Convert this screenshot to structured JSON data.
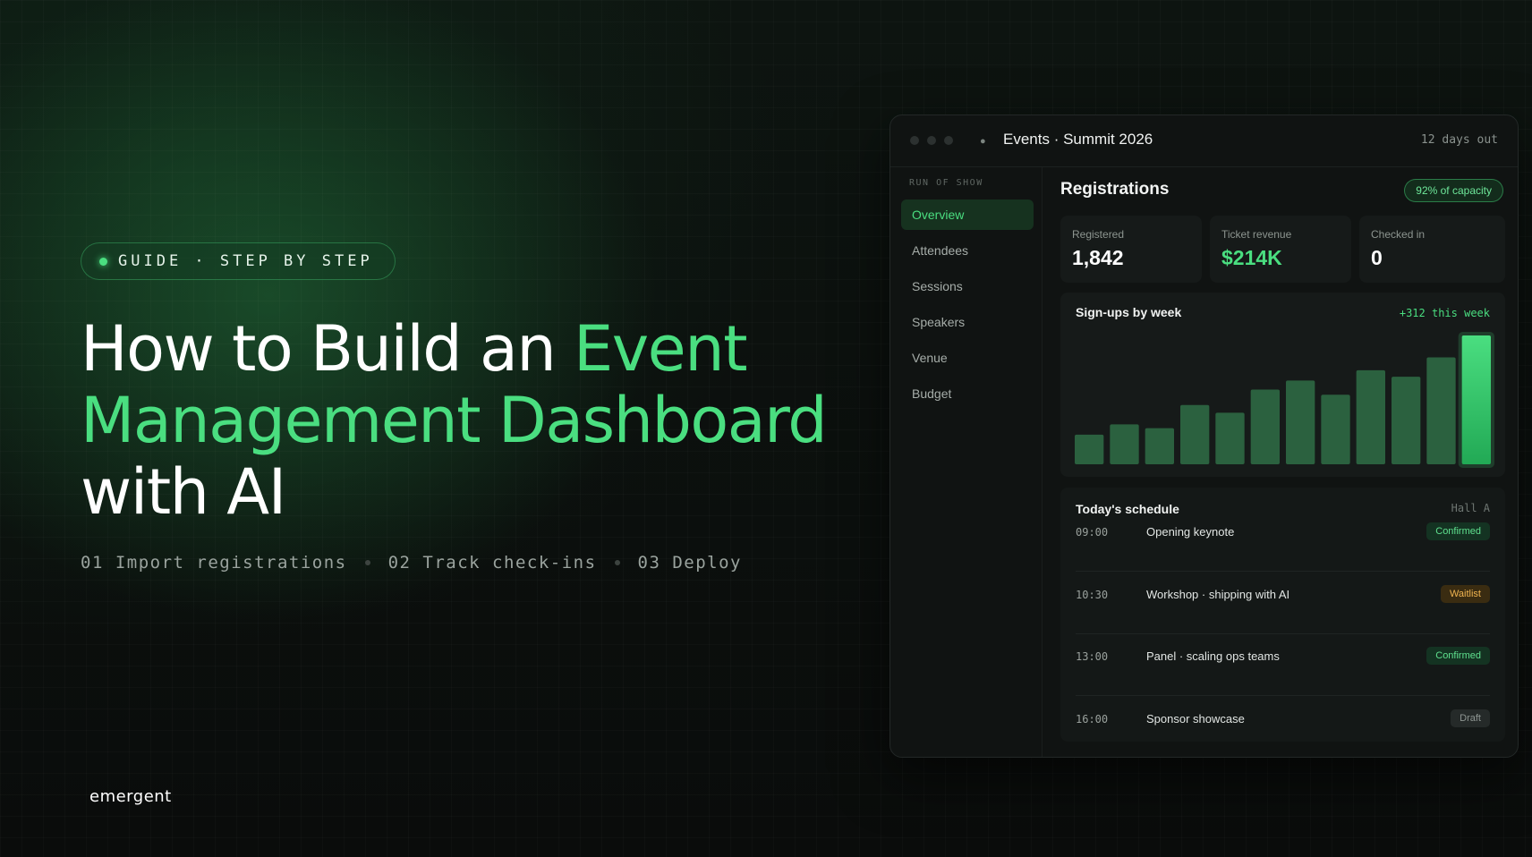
{
  "hero": {
    "pill_label": "GUIDE · STEP BY STEP",
    "headline_part1": "How to Build an ",
    "headline_accent": "Event Management Dashboard",
    "headline_part2": " with AI",
    "steps": [
      "01 Import registrations",
      "02 Track check-ins",
      "03 Deploy"
    ],
    "brand": "emergent",
    "accent_color": "#4ade80"
  },
  "window": {
    "title": "Events · Summit 2026",
    "countdown": "12 days out",
    "icon": "bulb-icon"
  },
  "sidebar": {
    "section_title": "RUN OF SHOW",
    "items": [
      {
        "label": "Overview",
        "active": true
      },
      {
        "label": "Attendees",
        "active": false
      },
      {
        "label": "Sessions",
        "active": false
      },
      {
        "label": "Speakers",
        "active": false
      },
      {
        "label": "Venue",
        "active": false
      },
      {
        "label": "Budget",
        "active": false
      }
    ]
  },
  "registrations": {
    "title": "Registrations",
    "capacity_badge": "92% of capacity",
    "kpis": [
      {
        "label": "Registered",
        "value": "1,842"
      },
      {
        "label": "Ticket revenue",
        "value": "$214K"
      },
      {
        "label": "Checked in",
        "value": "0"
      }
    ]
  },
  "chart_data": {
    "type": "bar",
    "title": "Sign-ups by week",
    "annotation": "+312 this week",
    "values": [
      23,
      31,
      28,
      46,
      40,
      58,
      65,
      54,
      73,
      68,
      83,
      100
    ]
  },
  "schedule": {
    "title": "Today's schedule",
    "hall": "Hall A",
    "rows": [
      {
        "time": "09:00",
        "name": "Opening keynote",
        "status": "Confirmed",
        "kind": "confirmed"
      },
      {
        "time": "10:30",
        "name": "Workshop · shipping with AI",
        "status": "Waitlist",
        "kind": "waitlist"
      },
      {
        "time": "13:00",
        "name": "Panel · scaling ops teams",
        "status": "Confirmed",
        "kind": "confirmed"
      },
      {
        "time": "16:00",
        "name": "Sponsor showcase",
        "status": "Draft",
        "kind": "draft"
      }
    ]
  }
}
